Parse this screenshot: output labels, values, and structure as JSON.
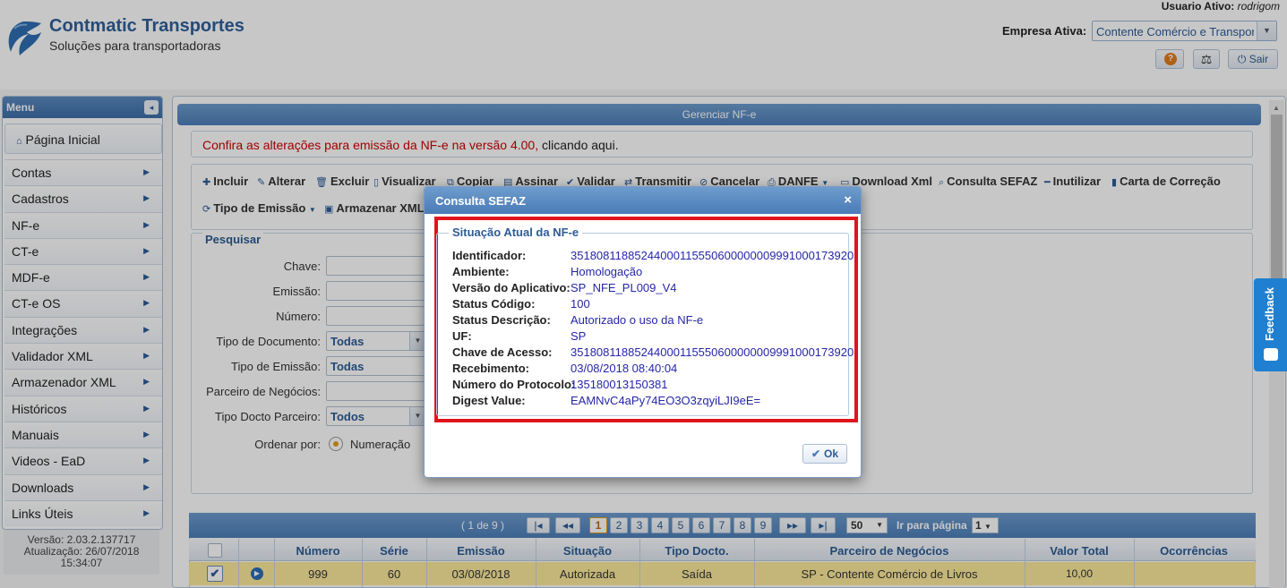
{
  "header": {
    "brand_title": "Contmatic Transportes",
    "brand_subtitle": "Soluções para transportadoras",
    "user_label": "Usuario Ativo:",
    "user_name": "rodrigom",
    "empresa_label": "Empresa Ativa:",
    "empresa_value": "Contente Comércio e Transporte",
    "sair_label": "Sair",
    "help_glyph": "?",
    "scale_glyph": "⚖"
  },
  "sidebar": {
    "menu_title": "Menu",
    "home_label": "Página Inicial",
    "items": [
      {
        "label": "Contas"
      },
      {
        "label": "Cadastros"
      },
      {
        "label": "NF-e"
      },
      {
        "label": "CT-e"
      },
      {
        "label": "MDF-e"
      },
      {
        "label": "CT-e OS"
      },
      {
        "label": "Integrações"
      },
      {
        "label": "Validador XML"
      },
      {
        "label": "Armazenador XML"
      },
      {
        "label": "Históricos"
      },
      {
        "label": "Manuais"
      },
      {
        "label": "Videos - EaD"
      },
      {
        "label": "Downloads"
      },
      {
        "label": "Links Úteis"
      }
    ],
    "version_line1": "Versão: 2.03.2.137717",
    "version_line2": "Atualização: 26/07/2018",
    "version_line3": "15:34:07"
  },
  "main": {
    "title": "Gerenciar NF-e",
    "notice_red": "Confira as alterações para emissão da NF-e na versão 4.00,",
    "notice_link": " clicando aqui.",
    "toolbar": {
      "incluir": "Incluir",
      "alterar": "Alterar",
      "excluir": "Excluir",
      "visualizar": "Visualizar",
      "copiar": "Copiar",
      "assinar": "Assinar",
      "validar": "Validar",
      "transmitir": "Transmitir",
      "cancelar": "Cancelar",
      "danfe": "DANFE",
      "download_xml": "Download Xml",
      "consulta_sefaz": "Consulta SEFAZ",
      "inutilizar": "Inutilizar",
      "carta_correcao": "Carta de Correção",
      "tipo_emissao": "Tipo de Emissão",
      "armazenar_xml": "Armazenar XML"
    },
    "search": {
      "legend": "Pesquisar",
      "chave": "Chave:",
      "emissao": "Emissão:",
      "numero": "Número:",
      "tipo_documento": "Tipo de Documento:",
      "tipo_documento_value": "Todas",
      "tipo_emissao": "Tipo de Emissão:",
      "tipo_emissao_value": "Todas",
      "parceiro": "Parceiro de Negócios:",
      "tipo_docto_parceiro": "Tipo Docto Parceiro:",
      "tipo_docto_parceiro_value": "Todos",
      "ordenar_por": "Ordenar por:",
      "ordenar_option": "Numeração"
    }
  },
  "grid": {
    "pager_info": "( 1 de 9 )",
    "pages": [
      "1",
      "2",
      "3",
      "4",
      "5",
      "6",
      "7",
      "8",
      "9"
    ],
    "current_page": "1",
    "nav_first": "|◂",
    "nav_prev": "◂◂",
    "nav_next": "▸▸",
    "nav_last": "▸|",
    "per_page": "50",
    "goto_label": "Ir para página",
    "goto_value": "1",
    "columns": [
      "Número",
      "Série",
      "Emissão",
      "Situação",
      "Tipo Docto.",
      "Parceiro de Negócios",
      "Valor Total",
      "Ocorrências"
    ],
    "row": {
      "numero": "999",
      "serie": "60",
      "emissao": "03/08/2018",
      "situacao": "Autorizada",
      "tipo": "Saída",
      "parceiro": "SP - Contente Comércio de Livros",
      "valor": "10,00",
      "ocorrencias": ""
    }
  },
  "feedback_label": "Feedback",
  "modal": {
    "title": "Consulta SEFAZ",
    "close_glyph": "×",
    "legend": "Situação Atual da NF-e",
    "rows": [
      {
        "key": "Identificador:",
        "value": "35180811885244000115550600000009991000173920"
      },
      {
        "key": "Ambiente:",
        "value": "Homologação"
      },
      {
        "key": "Versão do Aplicativo:",
        "value": "SP_NFE_PL009_V4"
      },
      {
        "key": "Status Código:",
        "value": "100"
      },
      {
        "key": "Status Descrição:",
        "value": "Autorizado o uso da NF-e"
      },
      {
        "key": "UF:",
        "value": "SP"
      },
      {
        "key": "Chave de Acesso:",
        "value": "35180811885244000115550600000009991000173920"
      },
      {
        "key": "Recebimento:",
        "value": "03/08/2018 08:40:04"
      },
      {
        "key": "Número do Protocolo:",
        "value": "135180013150381"
      },
      {
        "key": "Digest Value:",
        "value": "EAMNvC4aPy74EO3O3zqyiLJI9eE="
      }
    ],
    "ok_label": "Ok"
  },
  "colors": {
    "brand": "#2f5f99",
    "header_bar": "#4d7fb9",
    "highlight_row": "#fce99b",
    "red_frame": "#e0141c",
    "feedback": "#1f7fd0"
  }
}
